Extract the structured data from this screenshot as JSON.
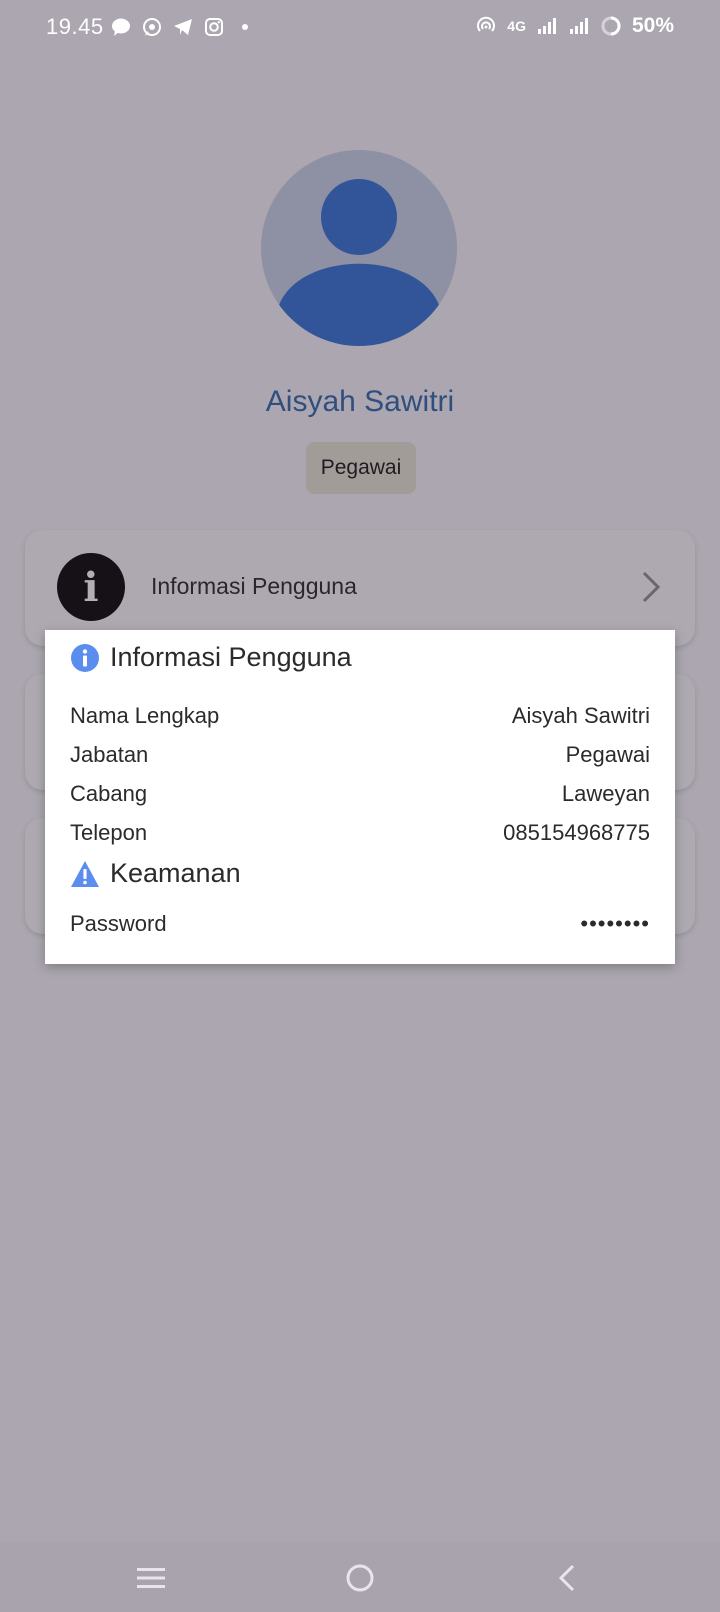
{
  "status_bar": {
    "time": "19.45",
    "network": "4G",
    "battery": "50%",
    "left_icons": [
      "message-icon",
      "whatsapp-icon",
      "telegram-icon",
      "instagram-icon",
      "dot-icon"
    ],
    "right_icons": [
      "hotspot-icon",
      "signal-4g-icon",
      "signal-icon",
      "battery-icon"
    ]
  },
  "profile": {
    "name": "Aisyah Sawitri",
    "role": "Pegawai"
  },
  "menu": {
    "items": [
      {
        "label": "Informasi Pengguna",
        "icon": "info-icon"
      }
    ]
  },
  "dialog": {
    "info_section": {
      "title": "Informasi Pengguna",
      "icon": "info-circle-icon",
      "rows": [
        {
          "label": "Nama Lengkap",
          "value": "Aisyah Sawitri"
        },
        {
          "label": "Jabatan",
          "value": "Pegawai"
        },
        {
          "label": "Cabang",
          "value": "Laweyan"
        },
        {
          "label": "Telepon",
          "value": "085154968775"
        }
      ]
    },
    "security_section": {
      "title": "Keamanan",
      "icon": "warning-icon",
      "password_label": "Password",
      "password_value": "••••••••"
    }
  },
  "nav": {
    "buttons": [
      "menu-nav-icon",
      "home-nav-icon",
      "back-nav-icon"
    ]
  },
  "colors": {
    "accent": "#2d64a8",
    "info_blue": "#5b8def",
    "badge_bg": "#e4e0d0"
  }
}
